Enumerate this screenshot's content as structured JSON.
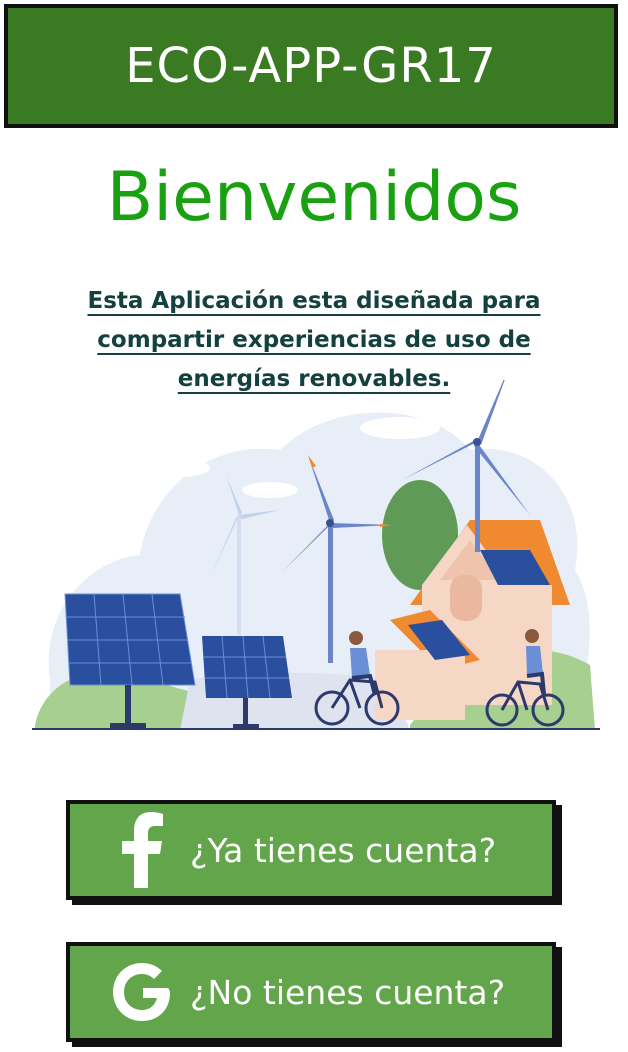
{
  "header": {
    "title": "ECO-APP-GR17"
  },
  "welcome": {
    "heading": "Bienvenidos"
  },
  "description": {
    "lines": [
      "Esta Aplicación esta diseñada para",
      "compartir experiencias de uso de",
      "energías renovables."
    ]
  },
  "buttons": {
    "login": {
      "label": "¿Ya tienes cuenta?",
      "icon": "facebook-icon"
    },
    "register": {
      "label": "¿No tienes cuenta?",
      "icon": "google-icon"
    }
  },
  "colors": {
    "header_bg": "#3a7a23",
    "welcome_text": "#1aa112",
    "description_text": "#14403f",
    "button_bg": "#62a54a"
  }
}
